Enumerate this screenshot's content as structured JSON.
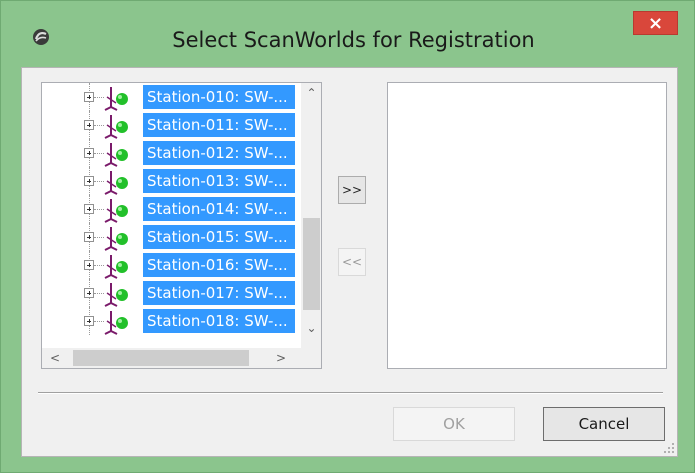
{
  "window": {
    "title": "Select ScanWorlds for Registration",
    "close_glyph": "×",
    "accent_color": "#8bc58d",
    "close_color": "#d9473b"
  },
  "tree": {
    "items": [
      {
        "label": "Station-010: SW-..."
      },
      {
        "label": "Station-011: SW-..."
      },
      {
        "label": "Station-012: SW-..."
      },
      {
        "label": "Station-013: SW-..."
      },
      {
        "label": "Station-014: SW-..."
      },
      {
        "label": "Station-015: SW-..."
      },
      {
        "label": "Station-016: SW-..."
      },
      {
        "label": "Station-017: SW-..."
      },
      {
        "label": "Station-018: SW-..."
      }
    ],
    "selection_color": "#3399ff",
    "icons": {
      "expander": "plus-box-icon",
      "item": "scan-station-icon"
    },
    "scroll_arrows": {
      "up": "⌃",
      "down": "⌄",
      "left": "<",
      "right": ">"
    }
  },
  "transfer": {
    "add_label": ">>",
    "remove_label": "<<"
  },
  "buttons": {
    "ok_label": "OK",
    "cancel_label": "Cancel"
  }
}
